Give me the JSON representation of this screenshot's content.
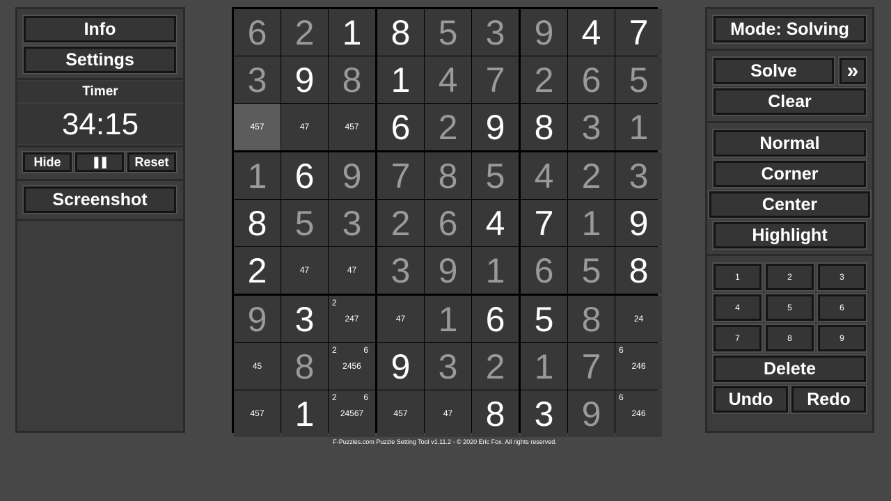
{
  "left_panel": {
    "info_label": "Info",
    "settings_label": "Settings",
    "timer_label": "Timer",
    "timer_value": "34:15",
    "hide_label": "Hide",
    "pause_label": "❚❚",
    "reset_label": "Reset",
    "screenshot_label": "Screenshot"
  },
  "right_panel": {
    "mode_label": "Mode: Solving",
    "solve_label": "Solve",
    "expand_label": "»",
    "clear_label": "Clear",
    "entry_modes": [
      "Normal",
      "Corner",
      "Center",
      "Highlight"
    ],
    "selected_entry_mode": "Center",
    "digits": [
      "1",
      "2",
      "3",
      "4",
      "5",
      "6",
      "7",
      "8",
      "9"
    ],
    "delete_label": "Delete",
    "undo_label": "Undo",
    "redo_label": "Redo"
  },
  "footer": "F-Puzzles.com Puzzle Setting Tool v1.11.2 - © 2020 Eric Fox. All rights reserved.",
  "selected_cell": [
    2,
    0
  ],
  "grid": [
    [
      {
        "v": "6",
        "t": "user"
      },
      {
        "v": "2",
        "t": "user"
      },
      {
        "v": "1",
        "t": "given"
      },
      {
        "v": "8",
        "t": "given"
      },
      {
        "v": "5",
        "t": "user"
      },
      {
        "v": "3",
        "t": "user"
      },
      {
        "v": "9",
        "t": "user"
      },
      {
        "v": "4",
        "t": "given"
      },
      {
        "v": "7",
        "t": "given"
      }
    ],
    [
      {
        "v": "3",
        "t": "user"
      },
      {
        "v": "9",
        "t": "given"
      },
      {
        "v": "8",
        "t": "user"
      },
      {
        "v": "1",
        "t": "given"
      },
      {
        "v": "4",
        "t": "user"
      },
      {
        "v": "7",
        "t": "user"
      },
      {
        "v": "2",
        "t": "user"
      },
      {
        "v": "6",
        "t": "user"
      },
      {
        "v": "5",
        "t": "user"
      }
    ],
    [
      {
        "c": "457"
      },
      {
        "c": "47"
      },
      {
        "c": "457"
      },
      {
        "v": "6",
        "t": "given"
      },
      {
        "v": "2",
        "t": "user"
      },
      {
        "v": "9",
        "t": "given"
      },
      {
        "v": "8",
        "t": "given"
      },
      {
        "v": "3",
        "t": "user"
      },
      {
        "v": "1",
        "t": "user"
      }
    ],
    [
      {
        "v": "1",
        "t": "user"
      },
      {
        "v": "6",
        "t": "given"
      },
      {
        "v": "9",
        "t": "user"
      },
      {
        "v": "7",
        "t": "user"
      },
      {
        "v": "8",
        "t": "user"
      },
      {
        "v": "5",
        "t": "user"
      },
      {
        "v": "4",
        "t": "user"
      },
      {
        "v": "2",
        "t": "user"
      },
      {
        "v": "3",
        "t": "user"
      }
    ],
    [
      {
        "v": "8",
        "t": "given"
      },
      {
        "v": "5",
        "t": "user"
      },
      {
        "v": "3",
        "t": "user"
      },
      {
        "v": "2",
        "t": "user"
      },
      {
        "v": "6",
        "t": "user"
      },
      {
        "v": "4",
        "t": "given"
      },
      {
        "v": "7",
        "t": "given"
      },
      {
        "v": "1",
        "t": "user"
      },
      {
        "v": "9",
        "t": "given"
      }
    ],
    [
      {
        "v": "2",
        "t": "given"
      },
      {
        "c": "47"
      },
      {
        "c": "47"
      },
      {
        "v": "3",
        "t": "user"
      },
      {
        "v": "9",
        "t": "user"
      },
      {
        "v": "1",
        "t": "user"
      },
      {
        "v": "6",
        "t": "user"
      },
      {
        "v": "5",
        "t": "user"
      },
      {
        "v": "8",
        "t": "given"
      }
    ],
    [
      {
        "v": "9",
        "t": "user"
      },
      {
        "v": "3",
        "t": "given"
      },
      {
        "c": "247",
        "tl": "2"
      },
      {
        "c": "47"
      },
      {
        "v": "1",
        "t": "user"
      },
      {
        "v": "6",
        "t": "given"
      },
      {
        "v": "5",
        "t": "given"
      },
      {
        "v": "8",
        "t": "user"
      },
      {
        "c": "24"
      }
    ],
    [
      {
        "c": "45"
      },
      {
        "v": "8",
        "t": "user"
      },
      {
        "c": "2456",
        "tl": "2",
        "tr": "6"
      },
      {
        "v": "9",
        "t": "given"
      },
      {
        "v": "3",
        "t": "user"
      },
      {
        "v": "2",
        "t": "user"
      },
      {
        "v": "1",
        "t": "user"
      },
      {
        "v": "7",
        "t": "user"
      },
      {
        "c": "246",
        "tl": "6"
      }
    ],
    [
      {
        "c": "457"
      },
      {
        "v": "1",
        "t": "given"
      },
      {
        "c": "24567",
        "tl": "2",
        "tr": "6"
      },
      {
        "c": "457"
      },
      {
        "c": "47"
      },
      {
        "v": "8",
        "t": "given"
      },
      {
        "v": "3",
        "t": "given"
      },
      {
        "v": "9",
        "t": "user"
      },
      {
        "c": "246",
        "tl": "6"
      }
    ]
  ]
}
